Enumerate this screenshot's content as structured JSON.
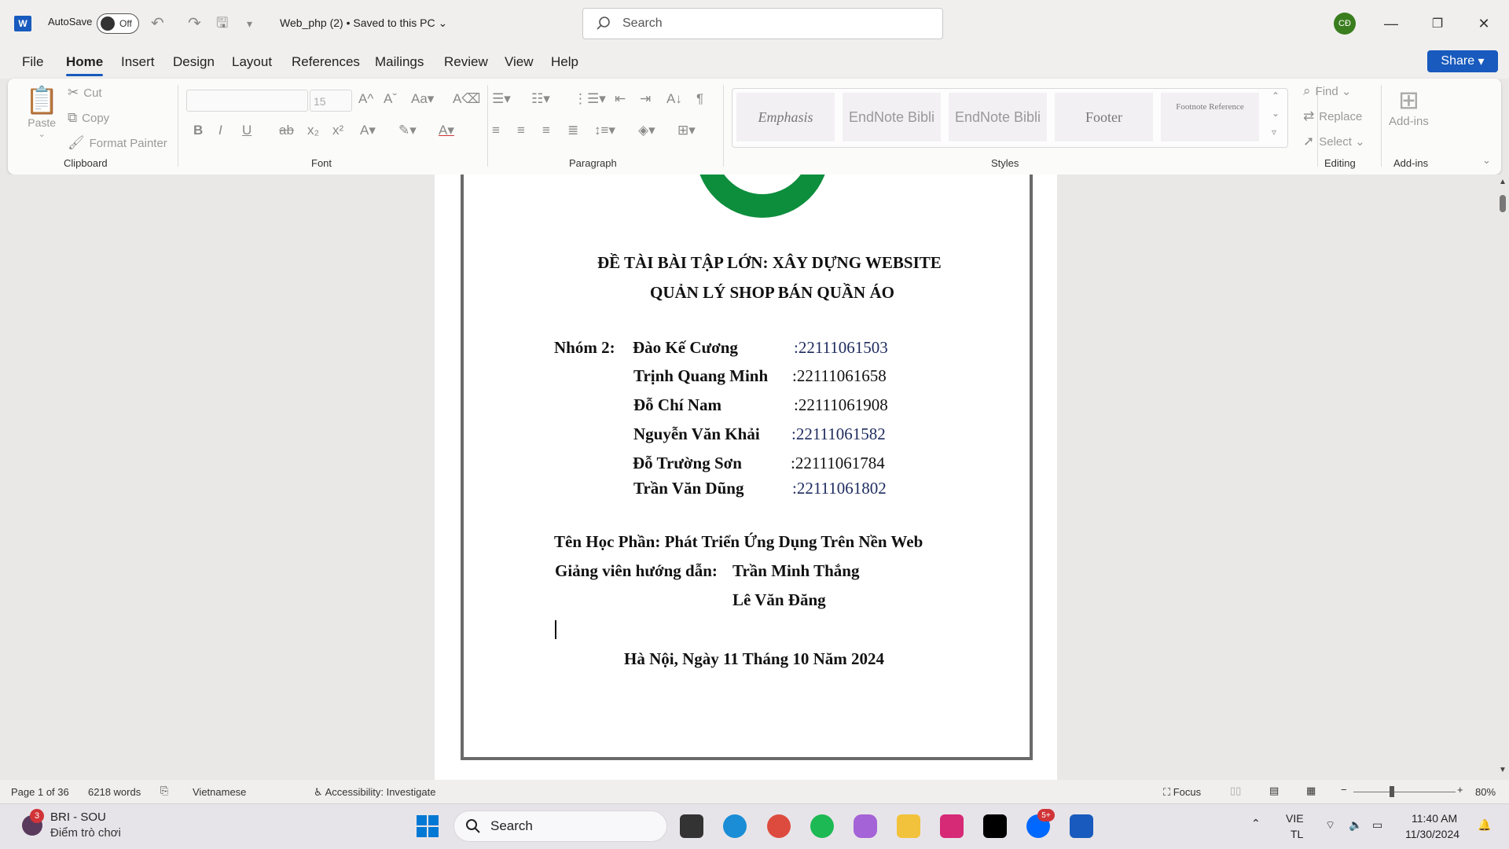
{
  "titlebar": {
    "app_icon": "word-icon",
    "autosave_label": "AutoSave",
    "autosave_state": "Off",
    "doc_title": "Web_php (2) • Saved to this PC",
    "search_placeholder": "Search",
    "user_initials": "CĐ"
  },
  "menu": {
    "items": [
      "File",
      "Home",
      "Insert",
      "Design",
      "Layout",
      "References",
      "Mailings",
      "Review",
      "View",
      "Help"
    ],
    "active": "Home",
    "share_label": "Share"
  },
  "ribbon": {
    "clipboard": {
      "paste": "Paste",
      "cut": "Cut",
      "copy": "Copy",
      "format_painter": "Format Painter",
      "label": "Clipboard"
    },
    "font": {
      "size": "15",
      "label": "Font"
    },
    "paragraph": {
      "label": "Paragraph"
    },
    "styles": {
      "items": [
        "Emphasis",
        "EndNote Bibli",
        "EndNote Bibli",
        "Footer",
        "Footnote Reference"
      ],
      "label": "Styles"
    },
    "editing": {
      "find": "Find",
      "replace": "Replace",
      "select": "Select",
      "label": "Editing"
    },
    "addins": {
      "button": "Add-ins",
      "label": "Add-ins"
    }
  },
  "document": {
    "title_line1": "ĐỀ TÀI BÀI TẬP LỚN: XÂY DỰNG WEBSITE",
    "title_line2": "QUẢN LÝ SHOP BÁN QUẦN ÁO",
    "group_label": "Nhóm 2:",
    "members": [
      {
        "name": "Đào Kế Cương",
        "id": ":22111061503"
      },
      {
        "name": "Trịnh Quang Minh",
        "id": ":22111061658"
      },
      {
        "name": "Đỗ Chí Nam",
        "id": ":22111061908"
      },
      {
        "name": "Nguyễn Văn Khải",
        "id": ":22111061582"
      },
      {
        "name": "Đỗ Trường Sơn",
        "id": ":22111061784"
      },
      {
        "name": "Trần Văn Dũng",
        "id": ":22111061802"
      }
    ],
    "course": "Tên Học Phần: Phát Triển Ứng Dụng Trên Nền Web",
    "instructor_label": "Giảng viên hướng dẫn:",
    "instructor1": "Trần Minh Thắng",
    "instructor2": "Lê Văn Đăng",
    "date_line": "Hà Nội, Ngày 11 Tháng 10 Năm 2024"
  },
  "status": {
    "page": "Page 1 of 36",
    "words": "6218 words",
    "language": "Vietnamese",
    "accessibility": "Accessibility: Investigate",
    "focus": "Focus",
    "zoom": "80%"
  },
  "taskbar": {
    "notif_title": "BRI - SOU",
    "notif_sub": "Điểm trò chơi",
    "notif_count": "3",
    "search": "Search",
    "zalo_badge": "5+",
    "lang": "VIE",
    "lang2": "TL",
    "time": "11:40 AM",
    "date": "11/30/2024"
  }
}
